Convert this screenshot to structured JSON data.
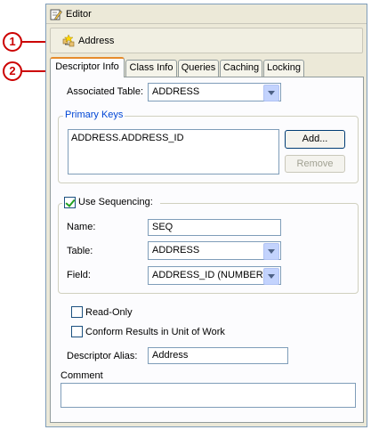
{
  "callouts": [
    "1",
    "2"
  ],
  "editor": {
    "title": "Editor",
    "icon": "pencil-editor-icon"
  },
  "descriptor": {
    "name": "Address",
    "icon": "class-tree-icon"
  },
  "tabs": [
    "Descriptor Info",
    "Class Info",
    "Queries",
    "Caching",
    "Locking"
  ],
  "form": {
    "associated_table_label": "Associated Table:",
    "associated_table_value": "ADDRESS",
    "primary_keys_title": "Primary Keys",
    "primary_keys": [
      "ADDRESS.ADDRESS_ID"
    ],
    "add_button": "Add...",
    "remove_button": "Remove",
    "use_sequencing_label": "Use Sequencing:",
    "name_label": "Name:",
    "name_value": "SEQ",
    "table_label": "Table:",
    "table_value": "ADDRESS",
    "field_label": "Field:",
    "field_value": "ADDRESS_ID (NUMBER)",
    "read_only_label": "Read-Only",
    "conform_label": "Conform Results in Unit of Work",
    "alias_label": "Descriptor Alias:",
    "alias_value": "Address",
    "comment_label": "Comment",
    "comment_value": ""
  },
  "colors": {
    "callout": "#cc0000",
    "tab_highlight": "#e68b2c",
    "group_title": "#0046d5"
  }
}
